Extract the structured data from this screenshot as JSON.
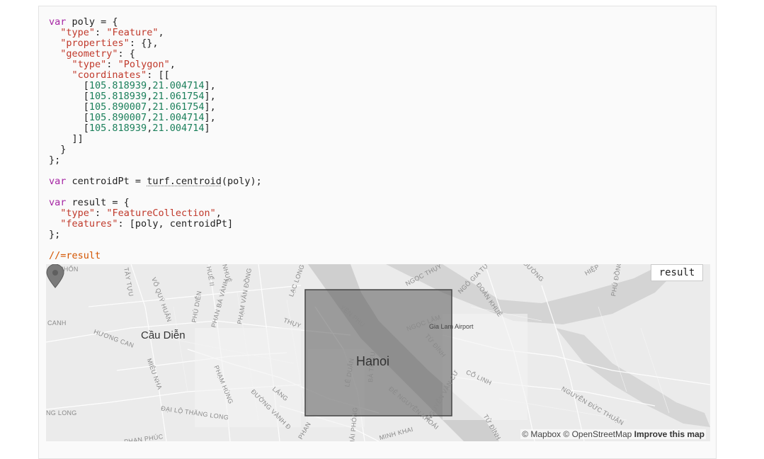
{
  "code": {
    "lines": [
      [
        [
          "kw",
          "var"
        ],
        [
          "t",
          " poly = {"
        ]
      ],
      [
        [
          "t",
          "  "
        ],
        [
          "key",
          "\"type\""
        ],
        [
          "t",
          ": "
        ],
        [
          "str",
          "\"Feature\""
        ],
        [
          "t",
          ","
        ]
      ],
      [
        [
          "t",
          "  "
        ],
        [
          "key",
          "\"properties\""
        ],
        [
          "t",
          ": {},"
        ]
      ],
      [
        [
          "t",
          "  "
        ],
        [
          "key",
          "\"geometry\""
        ],
        [
          "t",
          ": {"
        ]
      ],
      [
        [
          "t",
          "    "
        ],
        [
          "key",
          "\"type\""
        ],
        [
          "t",
          ": "
        ],
        [
          "str",
          "\"Polygon\""
        ],
        [
          "t",
          ","
        ]
      ],
      [
        [
          "t",
          "    "
        ],
        [
          "key",
          "\"coordinates\""
        ],
        [
          "t",
          ": [["
        ]
      ],
      [
        [
          "t",
          "      ["
        ],
        [
          "num",
          "105.818939"
        ],
        [
          "t",
          ","
        ],
        [
          "num",
          "21.004714"
        ],
        [
          "t",
          "],"
        ]
      ],
      [
        [
          "t",
          "      ["
        ],
        [
          "num",
          "105.818939"
        ],
        [
          "t",
          ","
        ],
        [
          "num",
          "21.061754"
        ],
        [
          "t",
          "],"
        ]
      ],
      [
        [
          "t",
          "      ["
        ],
        [
          "num",
          "105.890007"
        ],
        [
          "t",
          ","
        ],
        [
          "num",
          "21.061754"
        ],
        [
          "t",
          "],"
        ]
      ],
      [
        [
          "t",
          "      ["
        ],
        [
          "num",
          "105.890007"
        ],
        [
          "t",
          ","
        ],
        [
          "num",
          "21.004714"
        ],
        [
          "t",
          "],"
        ]
      ],
      [
        [
          "t",
          "      ["
        ],
        [
          "num",
          "105.818939"
        ],
        [
          "t",
          ","
        ],
        [
          "num",
          "21.004714"
        ],
        [
          "t",
          "]"
        ]
      ],
      [
        [
          "t",
          "    ]]"
        ]
      ],
      [
        [
          "t",
          "  }"
        ]
      ],
      [
        [
          "t",
          "};"
        ]
      ],
      [
        [
          "t",
          ""
        ]
      ],
      [
        [
          "kw",
          "var"
        ],
        [
          "t",
          " centroidPt = "
        ],
        [
          "fn",
          "turf.centroid"
        ],
        [
          "t",
          "(poly);"
        ]
      ],
      [
        [
          "t",
          ""
        ]
      ],
      [
        [
          "kw",
          "var"
        ],
        [
          "t",
          " result = {"
        ]
      ],
      [
        [
          "t",
          "  "
        ],
        [
          "key",
          "\"type\""
        ],
        [
          "t",
          ": "
        ],
        [
          "str",
          "\"FeatureCollection\""
        ],
        [
          "t",
          ","
        ]
      ],
      [
        [
          "t",
          "  "
        ],
        [
          "key",
          "\"features\""
        ],
        [
          "t",
          ": [poly, centroidPt]"
        ]
      ],
      [
        [
          "t",
          "};"
        ]
      ],
      [
        [
          "t",
          ""
        ]
      ],
      [
        [
          "cm",
          "//=result"
        ]
      ]
    ]
  },
  "map": {
    "result_button": "result",
    "city_main": "Hanoi",
    "city_secondary": "Cầu Diễn",
    "airport_label": "Gia Lam Airport",
    "street_labels": [
      "NHỔN",
      "TÂY TỰU",
      "VÕ QUÝ HUÂN",
      "PHÚ DIỄN",
      "HUẾ II",
      "NHUỆ",
      "PHẠM VĂN ĐỒNG",
      "LẠC LONG",
      "NGỌC THỤY",
      "NGÔ GIA TỰ",
      "ĐƯỜNG",
      "HIỆP",
      "PHÚ ĐỒNG",
      "CANH",
      "HƯƠNG CAN",
      "PHAN BÁ VÀNH",
      "YÊN PHỤ",
      "NGỌC LÂM",
      "ĐOÀN KHUÊ",
      "THỤY",
      "MIÊU NHA",
      "PHẠM HÙNG",
      "ĐƯỜNG VÀNH Đ",
      "LÁNG",
      "LÊ DUẨN",
      "BÀ TRIỆU",
      "TỪ ĐÌNH",
      "CỔ LINH",
      "NGUYỄN ĐỨC THUẬN",
      "NG LONG",
      "ĐẠI LỘ THĂNG LONG",
      "ĐÊ NGUYỄN KHOÁI",
      "NGUYỄN VĂN CỪ",
      "PHAN PHÚC",
      "MINH KHAI",
      "GIẢI PHÓNG",
      "TỬ ĐÌNH",
      "PHAN"
    ],
    "attribution": {
      "mapbox": "© Mapbox",
      "osm": "© OpenStreetMap",
      "improve": "Improve this map"
    },
    "polygon_fill": "#5a5a5a",
    "marker_color": "#7a7a7a"
  }
}
